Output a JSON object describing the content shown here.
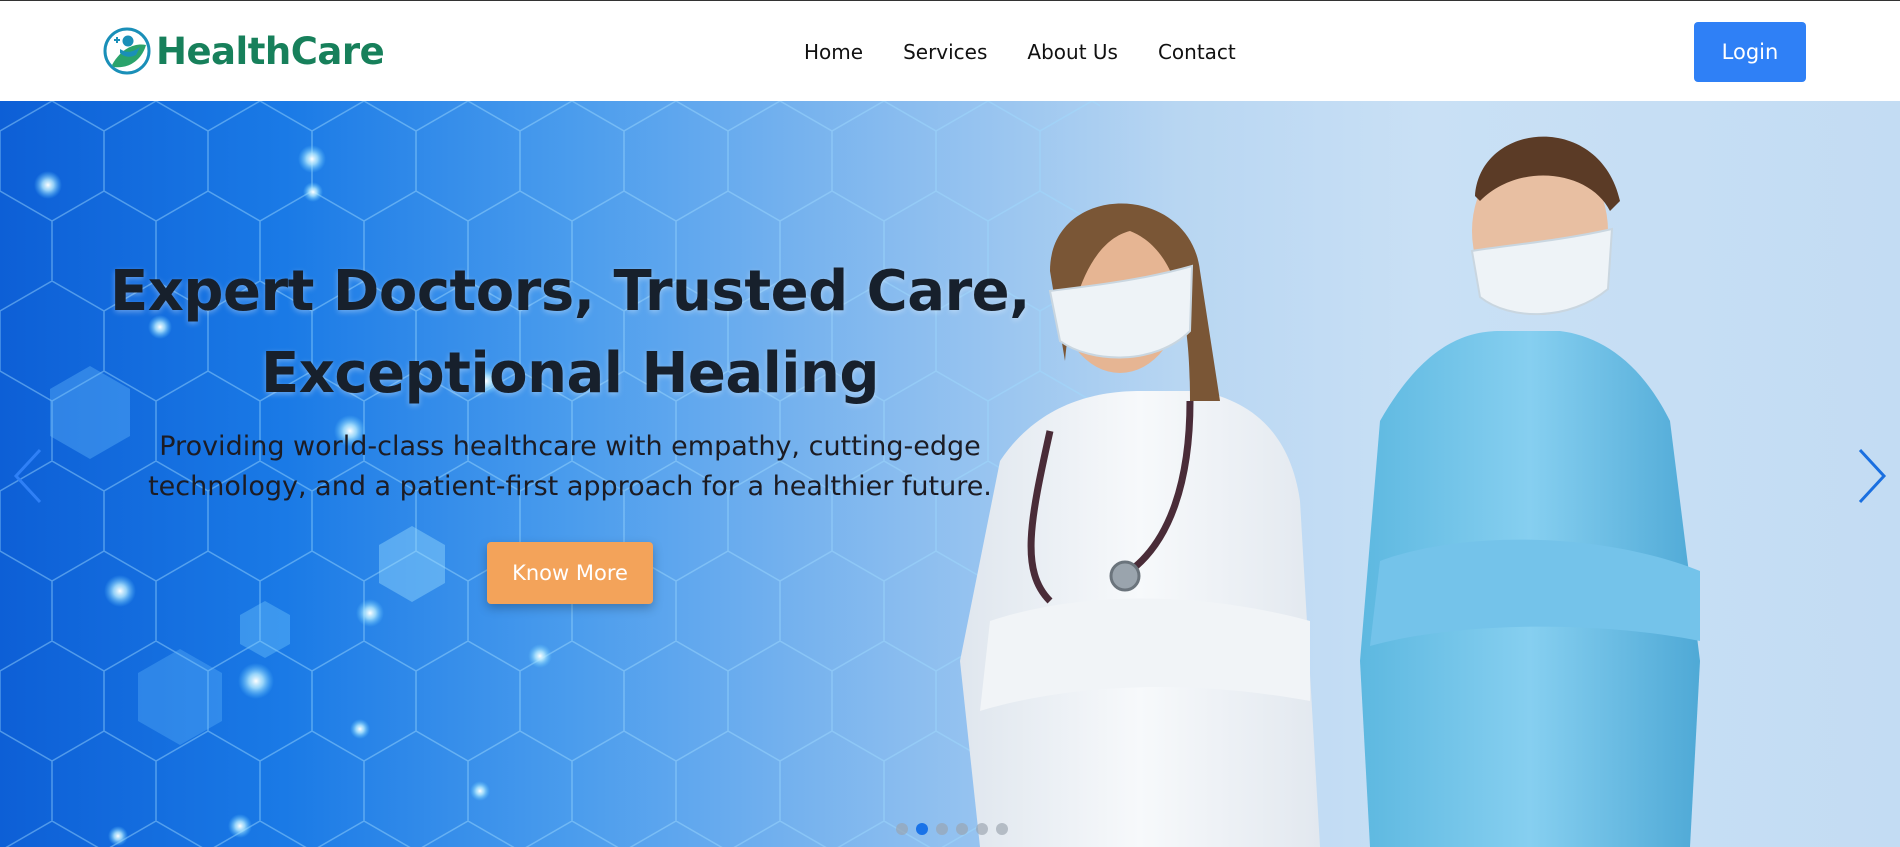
{
  "header": {
    "logo": {
      "icon": "healthcare-logo-icon",
      "text": "HealthCare",
      "color": "#17805b"
    },
    "nav": [
      {
        "label": "Home"
      },
      {
        "label": "Services"
      },
      {
        "label": "About Us"
      },
      {
        "label": "Contact"
      }
    ],
    "login_label": "Login",
    "login_color": "#2f80f6"
  },
  "hero": {
    "title_line1": "Expert Doctors, Trusted Care,",
    "title_line2": "Exceptional Healing",
    "subtitle_line1": "Providing world-class healthcare with empathy, cutting-edge",
    "subtitle_line2": "technology, and a patient-first approach for a healthier future.",
    "cta_label": "Know More",
    "cta_color": "#f3a35a",
    "prev_icon": "chevron-left-icon",
    "next_icon": "chevron-right-icon",
    "slides_total": 6,
    "active_slide": 2,
    "dot_active_color": "#1a73e8"
  }
}
